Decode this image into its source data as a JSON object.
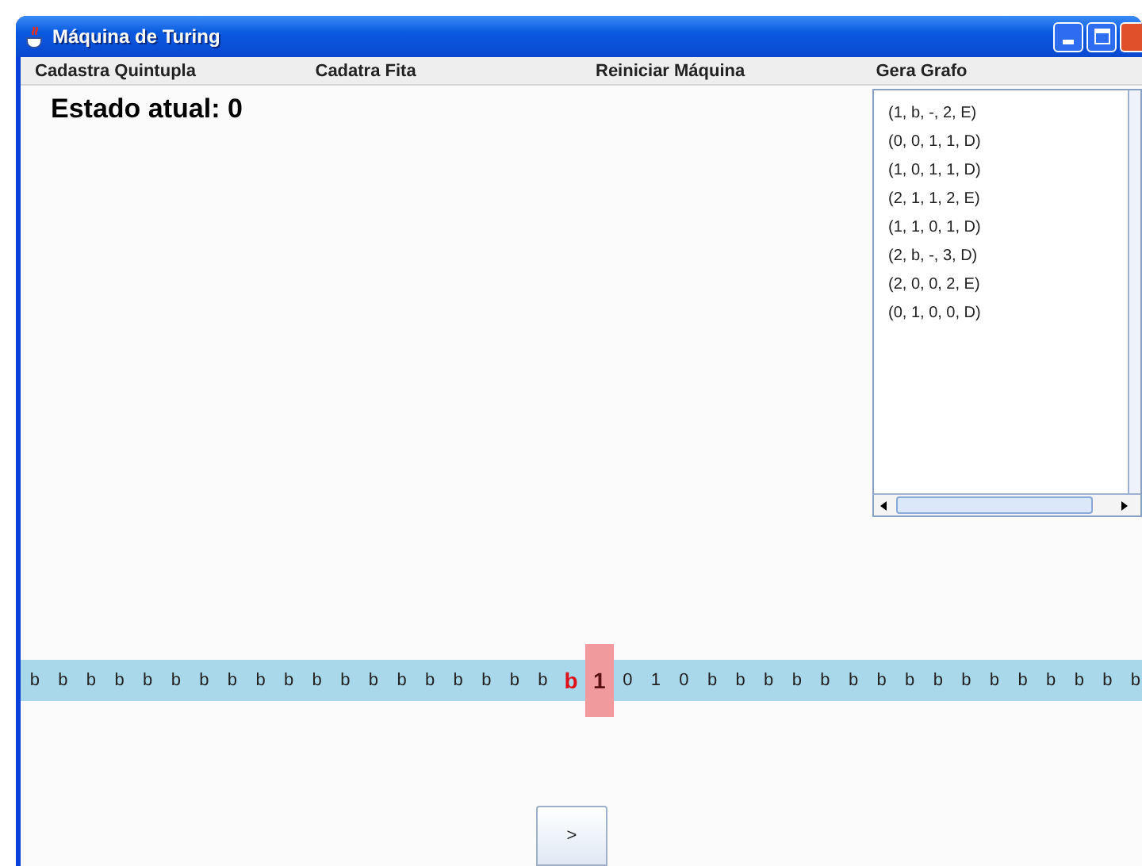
{
  "window": {
    "title": "Máquina de Turing"
  },
  "menu": [
    "Cadastra Quintupla",
    "Cadatra Fita",
    "Reiniciar Máquina",
    "Gera Grafo"
  ],
  "state_label": "Estado atual: 0",
  "quintuples": [
    "(1, b, -, 2, E)",
    "(0, 0, 1, 1, D)",
    "(1, 0, 1, 1, D)",
    "(2, 1, 1, 2, E)",
    "(1, 1, 0, 1, D)",
    "(2, b, -, 3, D)",
    "(2, 0, 0, 2, E)",
    "(0, 1, 0, 0, D)"
  ],
  "tape": [
    {
      "symbol": "b",
      "kind": "plain"
    },
    {
      "symbol": "b",
      "kind": "plain"
    },
    {
      "symbol": "b",
      "kind": "plain"
    },
    {
      "symbol": "b",
      "kind": "plain"
    },
    {
      "symbol": "b",
      "kind": "plain"
    },
    {
      "symbol": "b",
      "kind": "plain"
    },
    {
      "symbol": "b",
      "kind": "plain"
    },
    {
      "symbol": "b",
      "kind": "plain"
    },
    {
      "symbol": "b",
      "kind": "plain"
    },
    {
      "symbol": "b",
      "kind": "plain"
    },
    {
      "symbol": "b",
      "kind": "plain"
    },
    {
      "symbol": "b",
      "kind": "plain"
    },
    {
      "symbol": "b",
      "kind": "plain"
    },
    {
      "symbol": "b",
      "kind": "plain"
    },
    {
      "symbol": "b",
      "kind": "plain"
    },
    {
      "symbol": "b",
      "kind": "plain"
    },
    {
      "symbol": "b",
      "kind": "plain"
    },
    {
      "symbol": "b",
      "kind": "plain"
    },
    {
      "symbol": "b",
      "kind": "plain"
    },
    {
      "symbol": "b",
      "kind": "marked"
    },
    {
      "symbol": "1",
      "kind": "head"
    },
    {
      "symbol": "0",
      "kind": "plain"
    },
    {
      "symbol": "1",
      "kind": "plain"
    },
    {
      "symbol": "0",
      "kind": "plain"
    },
    {
      "symbol": "b",
      "kind": "plain"
    },
    {
      "symbol": "b",
      "kind": "plain"
    },
    {
      "symbol": "b",
      "kind": "plain"
    },
    {
      "symbol": "b",
      "kind": "plain"
    },
    {
      "symbol": "b",
      "kind": "plain"
    },
    {
      "symbol": "b",
      "kind": "plain"
    },
    {
      "symbol": "b",
      "kind": "plain"
    },
    {
      "symbol": "b",
      "kind": "plain"
    },
    {
      "symbol": "b",
      "kind": "plain"
    },
    {
      "symbol": "b",
      "kind": "plain"
    },
    {
      "symbol": "b",
      "kind": "plain"
    },
    {
      "symbol": "b",
      "kind": "plain"
    },
    {
      "symbol": "b",
      "kind": "plain"
    },
    {
      "symbol": "b",
      "kind": "plain"
    },
    {
      "symbol": "b",
      "kind": "plain"
    },
    {
      "symbol": "b",
      "kind": "plain"
    }
  ],
  "step_button": ">"
}
